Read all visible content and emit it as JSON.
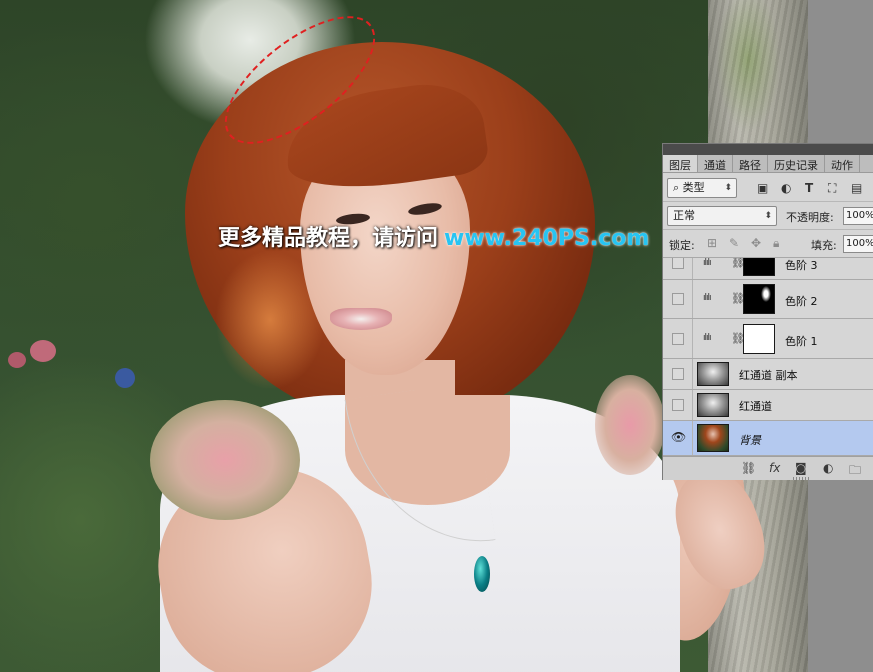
{
  "watermark": {
    "chinese_text": "更多精品教程，请访问",
    "url_text": "www.240PS.com",
    "chinese_color": "#ffffff",
    "url_color": "#27c4f2"
  },
  "selection": {
    "style": "marching-ants",
    "color": "#e02020"
  },
  "layers_panel": {
    "tabs": [
      {
        "label": "图层",
        "active": true
      },
      {
        "label": "通道",
        "active": false
      },
      {
        "label": "路径",
        "active": false
      },
      {
        "label": "历史记录",
        "active": false
      },
      {
        "label": "动作",
        "active": false
      }
    ],
    "filter": {
      "search_icon": "search-icon",
      "kind_label": "类型"
    },
    "filter_icons": [
      "image-filter-icon",
      "adjustment-filter-icon",
      "type-filter-icon",
      "shape-filter-icon",
      "smart-object-filter-icon"
    ],
    "blend_mode": "正常",
    "opacity_label": "不透明度:",
    "opacity_value": "100%",
    "lock_label": "锁定:",
    "fill_label": "填充:",
    "fill_value": "100%",
    "layers": [
      {
        "name": "色阶 3",
        "type": "adjustment",
        "visible": false,
        "mask": "black",
        "selected": false
      },
      {
        "name": "色阶 2",
        "type": "adjustment",
        "visible": false,
        "mask": "black-with-white-spot",
        "selected": false
      },
      {
        "name": "色阶 1",
        "type": "adjustment",
        "visible": false,
        "mask": "white",
        "selected": false
      },
      {
        "name": "红通道 副本",
        "type": "pixel",
        "visible": false,
        "selected": false
      },
      {
        "name": "红通道",
        "type": "pixel",
        "visible": false,
        "selected": false
      },
      {
        "name": "背景",
        "type": "background",
        "visible": true,
        "selected": true
      }
    ],
    "bottom_icons": [
      "link-icon",
      "fx-icon",
      "mask-icon",
      "adjustment-icon",
      "folder-icon"
    ],
    "selected_color": "#b4c9ef"
  }
}
